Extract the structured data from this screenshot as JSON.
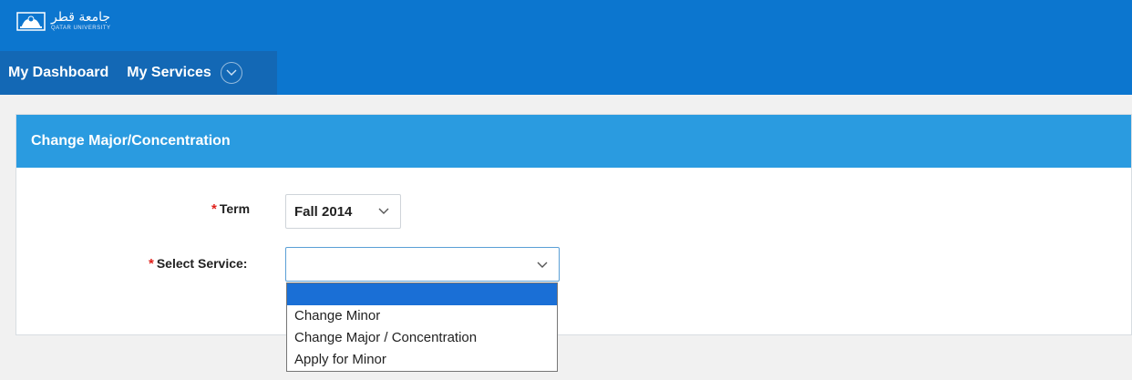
{
  "header": {
    "logo_arabic": "جامعة قطر",
    "logo_english": "QATAR UNIVERSITY",
    "nav_items": [
      "My Dashboard",
      "My Services"
    ]
  },
  "panel": {
    "title": "Change Major/Concentration"
  },
  "form": {
    "required_mark": "*",
    "term_label": "Term",
    "term_value": "Fall 2014",
    "service_label": "Select Service:",
    "service_value": "",
    "service_options": [
      "",
      "Change Minor",
      "Change Major / Concentration",
      "Apply for Minor"
    ]
  },
  "colors": {
    "header_bg": "#0c76cf",
    "nav_bg": "#1368b5",
    "panel_header_bg": "#2a9be0",
    "required": "#e0201a",
    "option_highlight": "#1a6fd6"
  },
  "icons": {
    "logo": "qatar-university-logo-icon",
    "nav_toggle": "chevron-down-circle-icon",
    "select_arrow": "chevron-down-icon"
  }
}
